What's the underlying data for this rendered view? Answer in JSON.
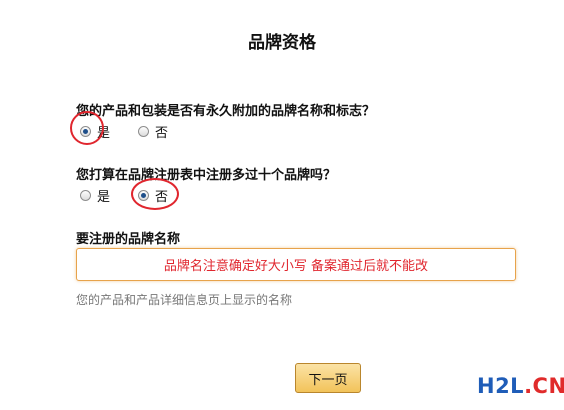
{
  "page": {
    "title": "品牌资格"
  },
  "question1": {
    "label": "您的产品和包装是否有永久附加的品牌名称和标志？",
    "yes": "是",
    "no": "否",
    "selected": "yes"
  },
  "question2": {
    "label": "您打算在品牌注册表中注册多过十个品牌吗？",
    "yes": "是",
    "no": "否",
    "selected": "no"
  },
  "brand": {
    "label": "要注册的品牌名称",
    "value": "品牌名注意确定好大小写 备案通过后就不能改",
    "hint": "您的产品和产品详细信息页上显示的名称"
  },
  "buttons": {
    "next": "下一页"
  },
  "watermark": {
    "part1": "H2L",
    "part2": ".CN"
  },
  "colors": {
    "annotation_red": "#e0262e",
    "field_border": "#e7a34b",
    "button_gold": "#f2c35a"
  }
}
